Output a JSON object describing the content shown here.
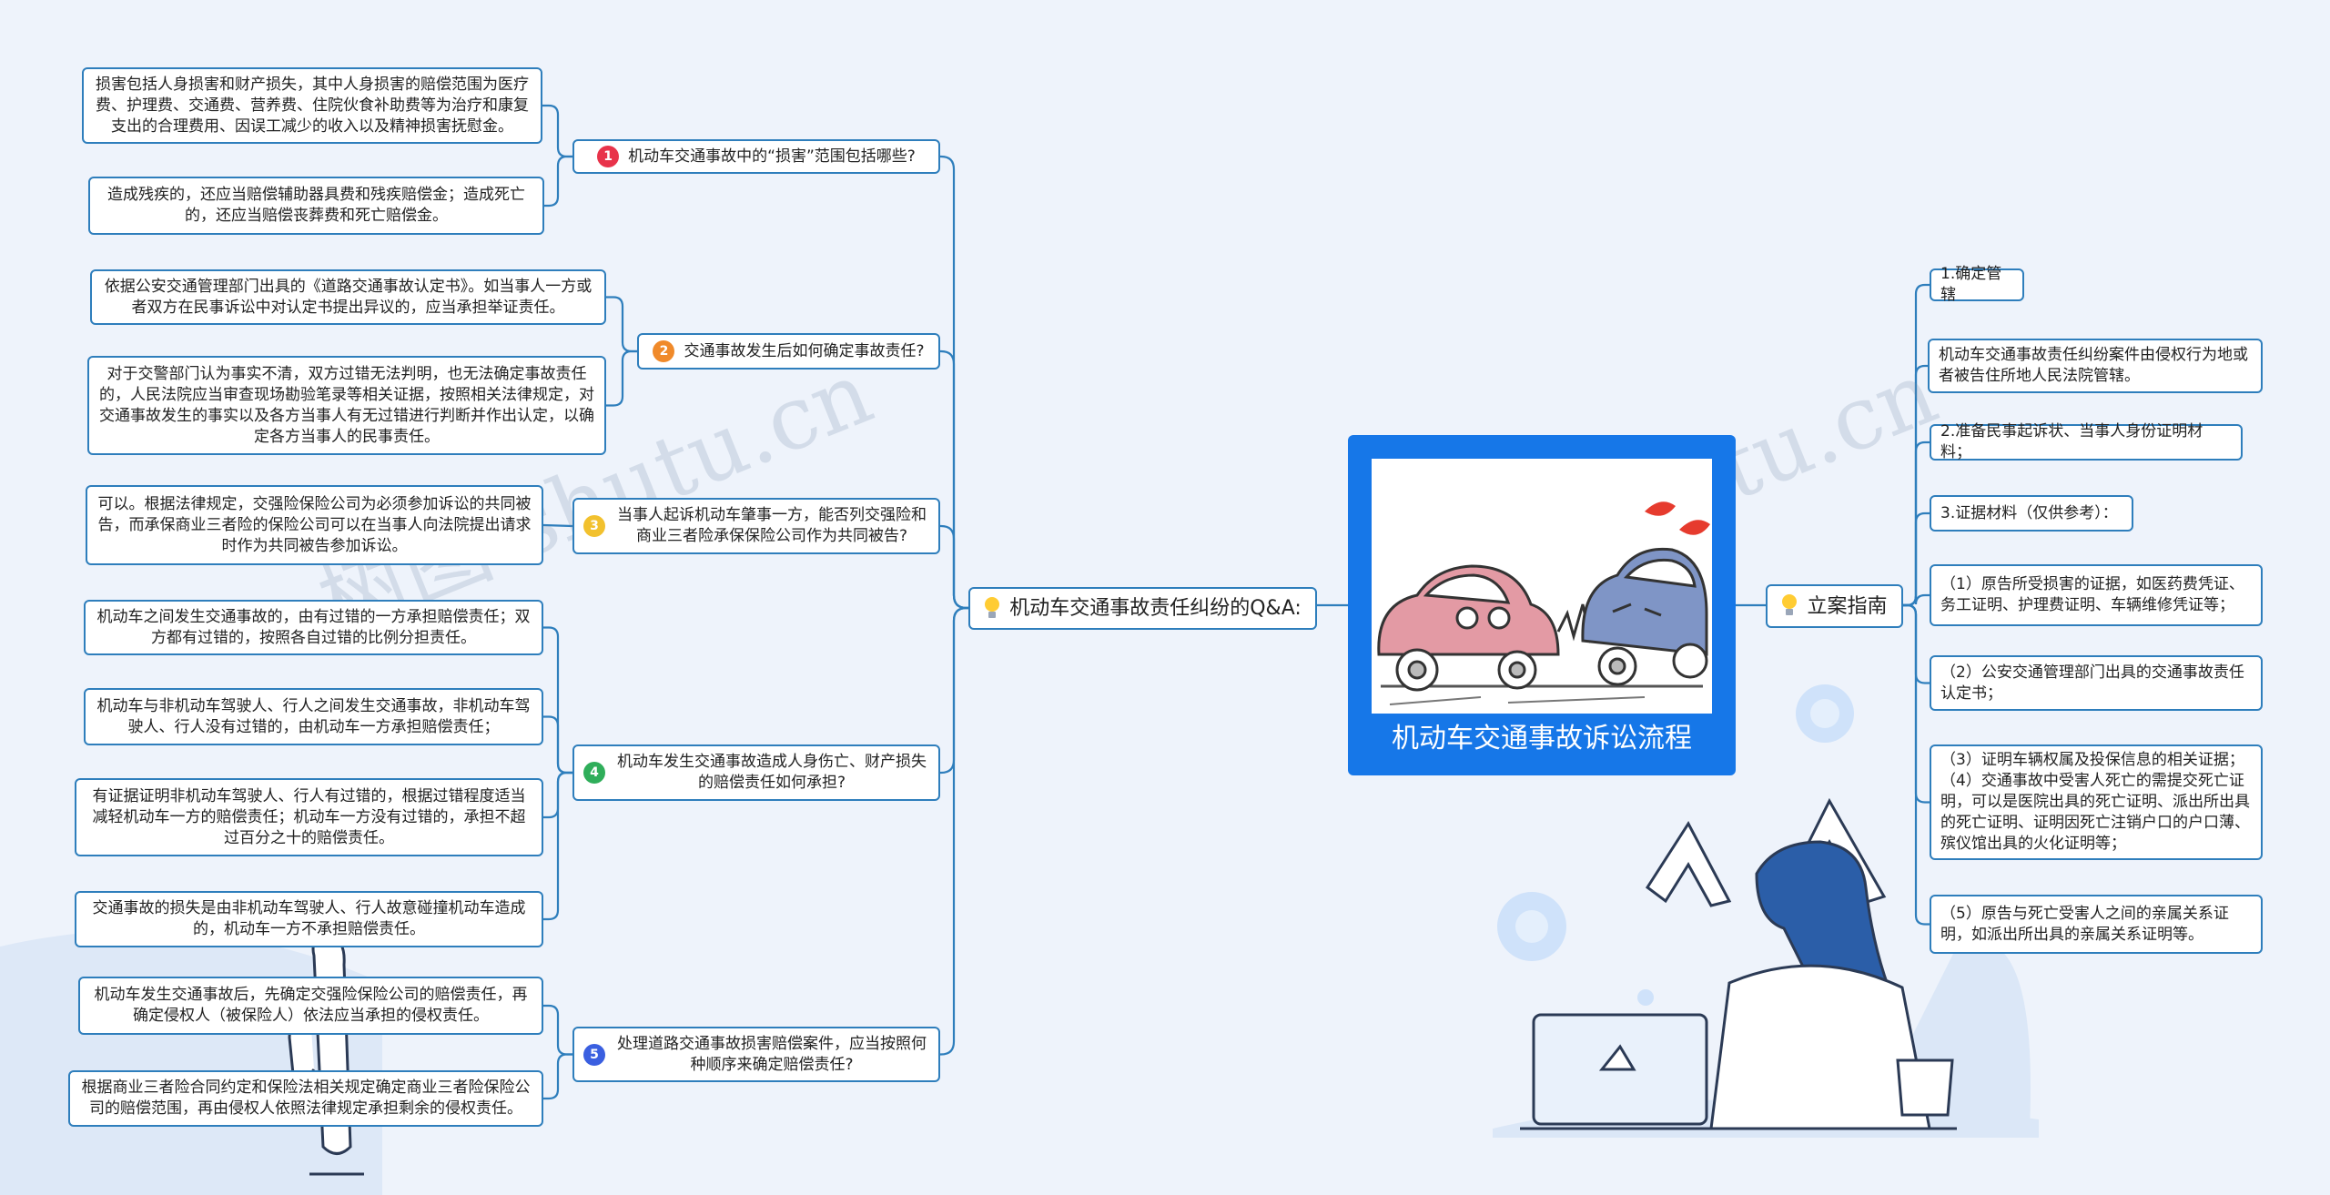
{
  "center": {
    "title": "机动车交通事故诉讼流程"
  },
  "watermark": "树图 shutu.cn",
  "left_branch": {
    "label": "机动车交通事故责任纠纷的Q&A:",
    "questions": [
      {
        "num": "1",
        "color": "#e8334a",
        "label": "机动车交通事故中的“损害”范围包括哪些?",
        "answers": [
          "损害包括人身损害和财产损失，其中人身损害的赔偿范围为医疗费、护理费、交通费、营养费、住院伙食补助费等为治疗和康复支出的合理费用、因误工减少的收入以及精神损害抚慰金。",
          "造成残疾的，还应当赔偿辅助器具费和残疾赔偿金；造成死亡的，还应当赔偿丧葬费和死亡赔偿金。"
        ]
      },
      {
        "num": "2",
        "color": "#f08a2a",
        "label": "交通事故发生后如何确定事故责任?",
        "answers": [
          "依据公安交通管理部门出具的《道路交通事故认定书》。如当事人一方或者双方在民事诉讼中对认定书提出异议的，应当承担举证责任。",
          "对于交警部门认为事实不清，双方过错无法判明，也无法确定事故责任的，人民法院应当审查现场勘验笔录等相关证据，按照相关法律规定，对交通事故发生的事实以及各方当事人有无过错进行判断并作出认定，以确定各方当事人的民事责任。"
        ]
      },
      {
        "num": "3",
        "color": "#f2c12e",
        "label": "当事人起诉机动车肇事一方，能否列交强险和商业三者险承保保险公司作为共同被告?",
        "answers": [
          "可以。根据法律规定，交强险保险公司为必须参加诉讼的共同被告，而承保商业三者险的保险公司可以在当事人向法院提出请求时作为共同被告参加诉讼。"
        ]
      },
      {
        "num": "4",
        "color": "#2fae5a",
        "label": "机动车发生交通事故造成人身伤亡、财产损失的赔偿责任如何承担?",
        "answers": [
          "机动车之间发生交通事故的，由有过错的一方承担赔偿责任；双方都有过错的，按照各自过错的比例分担责任。",
          "机动车与非机动车驾驶人、行人之间发生交通事故，非机动车驾驶人、行人没有过错的，由机动车一方承担赔偿责任；",
          "有证据证明非机动车驾驶人、行人有过错的，根据过错程度适当减轻机动车一方的赔偿责任；机动车一方没有过错的，承担不超过百分之十的赔偿责任。",
          "交通事故的损失是由非机动车驾驶人、行人故意碰撞机动车造成的，机动车一方不承担赔偿责任。"
        ]
      },
      {
        "num": "5",
        "color": "#3a5fe0",
        "label": "处理道路交通事故损害赔偿案件，应当按照何种顺序来确定赔偿责任?",
        "answers": [
          "机动车发生交通事故后，先确定交强险保险公司的赔偿责任，再确定侵权人（被保险人）依法应当承担的侵权责任。",
          "根据商业三者险合同约定和保险法相关规定确定商业三者险保险公司的赔偿范围，再由侵权人依照法律规定承担剩余的侵权责任。"
        ]
      }
    ]
  },
  "right_branch": {
    "label": "立案指南",
    "items": [
      "1.确定管辖",
      "机动车交通事故责任纠纷案件由侵权行为地或者被告住所地人民法院管辖。",
      "2.准备民事起诉状、当事人身份证明材料；",
      "3.证据材料（仅供参考）：",
      "（1）原告所受损害的证据，如医药费凭证、务工证明、护理费证明、车辆维修凭证等；",
      "（2）公安交通管理部门出具的交通事故责任认定书；",
      "（3）证明车辆权属及投保信息的相关证据；（4）交通事故中受害人死亡的需提交死亡证明，可以是医院出具的死亡证明、派出所出具的死亡证明、证明因死亡注销户口的户口薄、殡仪馆出具的火化证明等；",
      "（5）原告与死亡受害人之间的亲属关系证明，如派出所出具的亲属关系证明等。"
    ]
  },
  "colors": {
    "line": "#2e7ebc",
    "border": "#2e7ebc",
    "center_bg": "#1677e8"
  }
}
